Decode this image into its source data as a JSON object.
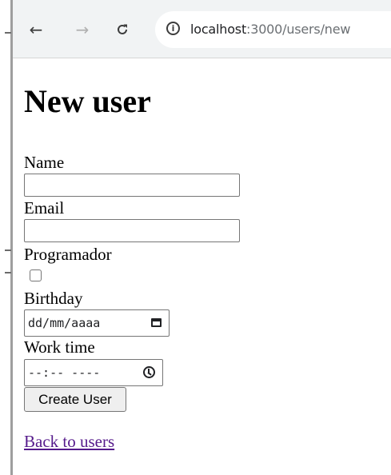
{
  "browser": {
    "url_host": "localhost",
    "url_path": ":3000/users/new",
    "back_icon": "back-arrow-icon",
    "forward_icon": "forward-arrow-icon",
    "reload_icon": "reload-icon",
    "info_icon": "info-icon"
  },
  "page": {
    "title": "New user",
    "form": {
      "name_label": "Name",
      "name_value": "",
      "email_label": "Email",
      "email_value": "",
      "programador_label": "Programador",
      "programador_checked": false,
      "birthday_label": "Birthday",
      "birthday_placeholder": "dd/mm/aaaa",
      "work_time_label": "Work time",
      "work_time_placeholder": "--:-- ----",
      "submit_label": "Create User"
    },
    "back_link": "Back to users"
  },
  "colors": {
    "toolbar_bg": "#f1f3f4",
    "link_visited": "#551a8b"
  }
}
